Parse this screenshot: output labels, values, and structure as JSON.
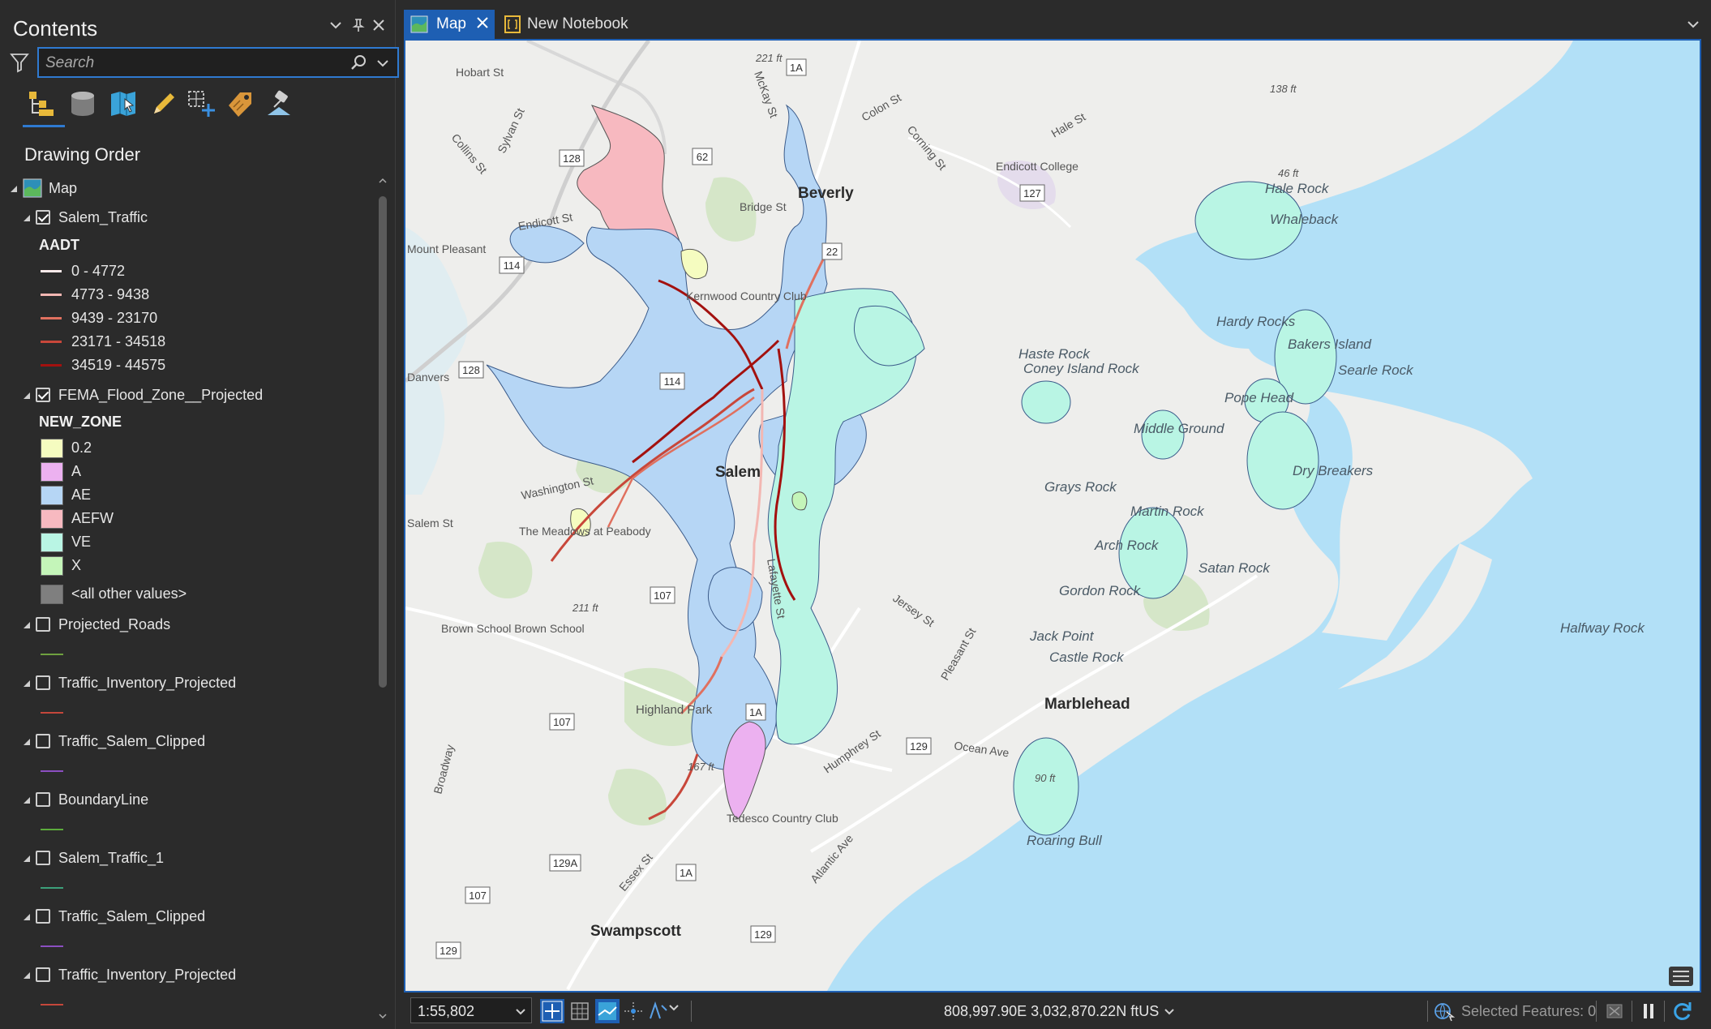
{
  "contents": {
    "title": "Contents",
    "search_placeholder": "Search",
    "view_tabs": [
      "list-by-drawing-order",
      "list-by-source",
      "list-by-selection",
      "list-by-editing",
      "list-by-snapping",
      "list-by-labeling",
      "list-by-perspective-imagery"
    ],
    "heading": "Drawing Order",
    "map_label": "Map",
    "layers": {
      "salem_traffic": {
        "name": "Salem_Traffic",
        "checked": true,
        "field": "AADT",
        "classes": [
          {
            "label": "0 - 4772",
            "color": "#fbeaea"
          },
          {
            "label": "4773 - 9438",
            "color": "#f3b7b2"
          },
          {
            "label": "9439 - 23170",
            "color": "#e0705f"
          },
          {
            "label": "23171 - 34518",
            "color": "#c8473a"
          },
          {
            "label": "34519 - 44575",
            "color": "#a3110f"
          }
        ]
      },
      "fema": {
        "name": "FEMA_Flood_Zone__Projected",
        "checked": true,
        "field": "NEW_ZONE",
        "classes": [
          {
            "label": "0.2",
            "color": "#f5fcc0"
          },
          {
            "label": "A",
            "color": "#ecb1f0"
          },
          {
            "label": "AE",
            "color": "#b6d6f5"
          },
          {
            "label": "AEFW",
            "color": "#f7b9c0"
          },
          {
            "label": "VE",
            "color": "#b9f5e4"
          },
          {
            "label": "X",
            "color": "#c4f5b9"
          },
          {
            "label": "<all other values>",
            "color": "#7f7f7f"
          }
        ]
      },
      "others": [
        {
          "name": "Projected_Roads",
          "line_color": "#6fa13f"
        },
        {
          "name": "Traffic_Inventory_Projected",
          "line_color": "#c4473b"
        },
        {
          "name": "Traffic_Salem_Clipped",
          "line_color": "#8b4fc1"
        },
        {
          "name": "BoundaryLine",
          "line_color": "#5cab3c"
        },
        {
          "name": "Salem_Traffic_1",
          "line_color": "#3ca07a"
        },
        {
          "name": "Traffic_Salem_Clipped",
          "line_color": "#8b4fc1"
        },
        {
          "name": "Traffic_Inventory_Projected",
          "line_color": "#c4473b"
        }
      ]
    }
  },
  "tabs": [
    {
      "label": "Map",
      "active": true
    },
    {
      "label": "New Notebook",
      "active": false
    }
  ],
  "map": {
    "place_labels": [
      "Beverly",
      "Salem",
      "Marblehead",
      "Swampscott"
    ],
    "poi_labels": [
      "Endicott College",
      "Highland Park",
      "Tedesco Country Club",
      "The Meadows at Peabody",
      "Brown School Brown School",
      "Kernwood Country Club"
    ],
    "street_labels": [
      "Hobart St",
      "Collins St",
      "Sylvan St",
      "McKay St",
      "Colon St",
      "Corning St",
      "Hale St",
      "Bridge St",
      "Endicott St",
      "Washington St",
      "Jersey St",
      "Pleasant St",
      "Humphrey St",
      "Ocean Ave",
      "Atlantic Ave",
      "Essex St",
      "Broadway",
      "Lafayette St"
    ],
    "water_labels": [
      "Hale Rock",
      "Whaleback",
      "Hardy Rocks",
      "Bakers Island",
      "Searle Rock",
      "Haste Rock",
      "Coney Island Rock",
      "Pope Head",
      "Middle Ground",
      "Dry Breakers",
      "Grays Rock",
      "Martin Rock",
      "Arch Rock",
      "Satan Rock",
      "Gordon Rock",
      "Jack Point",
      "Castle Rock",
      "Halfway Rock",
      "Roaring Bull"
    ],
    "elevations": [
      "221 ft",
      "138 ft",
      "46 ft",
      "211 ft",
      "167 ft",
      "90 ft"
    ],
    "shields": [
      "1A",
      "62",
      "128",
      "127",
      "22",
      "114",
      "128",
      "114",
      "107",
      "107",
      "1A",
      "129",
      "129A",
      "1A",
      "107",
      "129",
      "129"
    ],
    "partial_labels": [
      "Mount Pleasant",
      "Danvers",
      "Salem St"
    ]
  },
  "status": {
    "scale": "1:55,802",
    "coordinates": "808,997.90E 3,032,870.22N ftUS",
    "selected_features": "Selected Features: 0"
  }
}
